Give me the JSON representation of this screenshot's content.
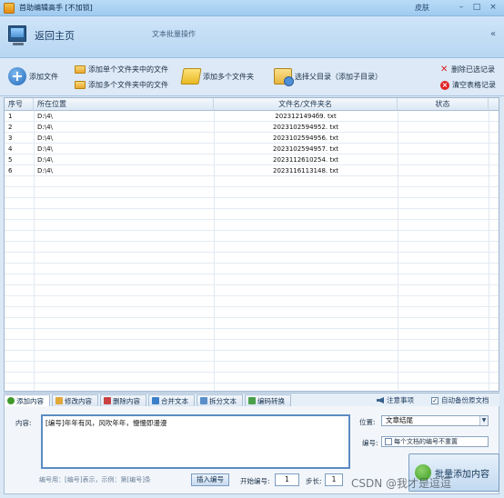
{
  "window": {
    "title": "首助编辑高手 [不加锁]",
    "skin_label": "皮肤",
    "min": "–",
    "max": "□",
    "close": "×"
  },
  "header": {
    "home_label": "返回主页",
    "section_title": "文本批量操作",
    "collapse": "«"
  },
  "toolbar": {
    "add_file": "添加文件",
    "add_single_folder": "添加单个文件夹中的文件",
    "add_multi_folder": "添加多个文件夹中的文件",
    "add_multi_dirs": "添加多个文件夹",
    "select_parent": "选择父目录（添加子目录）",
    "delete_selected": "删除已选记录",
    "clear_table": "清空表格记录"
  },
  "table": {
    "columns": [
      "序号",
      "所在位置",
      "文件名/文件夹名",
      "状态"
    ],
    "rows": [
      {
        "index": "1",
        "location": "D:\\4\\",
        "name": "2023121494б9. txt",
        "status": ""
      },
      {
        "index": "2",
        "location": "D:\\4\\",
        "name": "2023102594952. txt",
        "status": ""
      },
      {
        "index": "3",
        "location": "D:\\4\\",
        "name": "2023102594956. txt",
        "status": ""
      },
      {
        "index": "4",
        "location": "D:\\4\\",
        "name": "2023102594957. txt",
        "status": ""
      },
      {
        "index": "5",
        "location": "D:\\4\\",
        "name": "2023112610254. txt",
        "status": ""
      },
      {
        "index": "6",
        "location": "D:\\4\\",
        "name": "2023116113148. txt",
        "status": ""
      }
    ]
  },
  "tabs": [
    "添加内容",
    "修改内容",
    "删除内容",
    "合并文本",
    "拆分文本",
    "编码转换"
  ],
  "notes_label": "注意事项",
  "auto_backup_label": "自动备份原文档",
  "form": {
    "content_label": "内容:",
    "content_value": "[编号]年年有风，风吹年年，慢慢即漫漫",
    "position_label": "位置:",
    "position_value": "文章结尾",
    "number_label": "编号:",
    "no_repeat_label": "每个文档的编号不重置",
    "hint": "编号用：[编号]表示，示例：第[编号]条",
    "insert_button": "插入编号",
    "start_label": "开始编号:",
    "start_value": "1",
    "step_label": "步长:",
    "step_value": "1",
    "batch_button": "批量添加内容"
  },
  "watermark": "CSDN @我才是逗逗"
}
